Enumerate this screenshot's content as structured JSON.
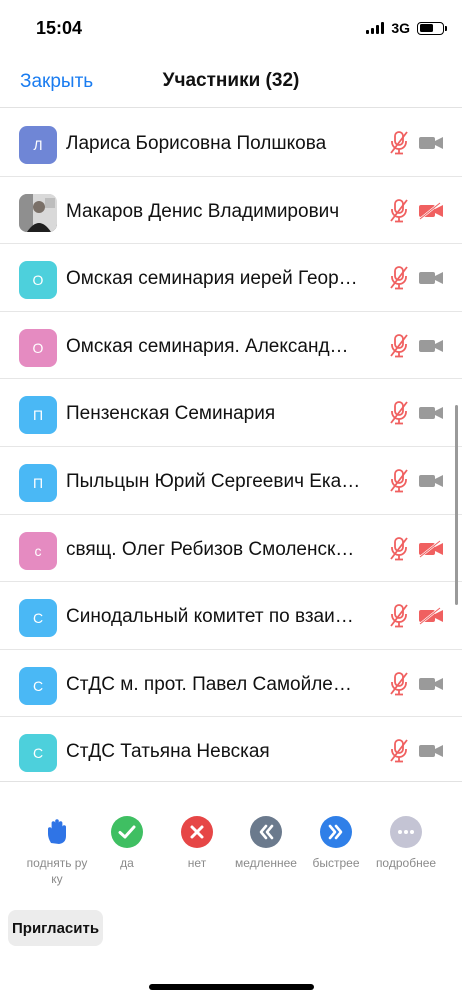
{
  "status_bar": {
    "time": "15:04",
    "network": "3G",
    "battery_level": 0.6
  },
  "nav": {
    "close_label": "Закрыть",
    "title": "Участники (32)",
    "accent_color": "#1a7cf0"
  },
  "participants": [
    {
      "initial": "Л",
      "avatar_color": "#6f86d6",
      "name": "Лариса Борисовна Полшкова",
      "mic_muted": true,
      "video_off": false
    },
    {
      "initial": "",
      "avatar_type": "photo",
      "name": "Макаров Денис Владимирович",
      "mic_muted": true,
      "video_off": true
    },
    {
      "initial": "О",
      "avatar_color": "#4dd0dc",
      "name": "Омская семинария иерей Геор…",
      "mic_muted": true,
      "video_off": false
    },
    {
      "initial": "О",
      "avatar_color": "#e58bc1",
      "name": "Омская семинария. Александ…",
      "mic_muted": true,
      "video_off": false
    },
    {
      "initial": "П",
      "avatar_color": "#4ab8f5",
      "name": "Пензенская Семинария",
      "mic_muted": true,
      "video_off": false
    },
    {
      "initial": "П",
      "avatar_color": "#4ab8f5",
      "name": "Пыльцын Юрий Сергеевич Ека…",
      "mic_muted": true,
      "video_off": false
    },
    {
      "initial": "с",
      "avatar_color": "#e58bc1",
      "name": "свящ. Олег Ребизов Смоленск…",
      "mic_muted": true,
      "video_off": true
    },
    {
      "initial": "С",
      "avatar_color": "#4ab8f5",
      "name": "Синодальный комитет по взаи…",
      "mic_muted": true,
      "video_off": true
    },
    {
      "initial": "С",
      "avatar_color": "#4ab8f5",
      "name": "СтДС м. прот. Павел Самойле…",
      "mic_muted": true,
      "video_off": false
    },
    {
      "initial": "С",
      "avatar_color": "#4dd0dc",
      "name": "СтДС Татьяна Невская",
      "mic_muted": true,
      "video_off": false
    }
  ],
  "reactions": [
    {
      "icon": "raise-hand-icon",
      "label": "поднять руку",
      "color": "#2f74e6"
    },
    {
      "icon": "checkmark-icon",
      "label": "да",
      "color": "#3fbf62"
    },
    {
      "icon": "cross-icon",
      "label": "нет",
      "color": "#e64646"
    },
    {
      "icon": "rewind-icon",
      "label": "медленнее",
      "color": "#6b7a8d"
    },
    {
      "icon": "fast-forward-icon",
      "label": "быстрее",
      "color": "#2f7fe8"
    },
    {
      "icon": "more-icon",
      "label": "подробнее",
      "color": "#c4c4d4"
    }
  ],
  "invite_label": "Пригласить",
  "colors": {
    "muted_red": "#f06060",
    "camera_gray": "#9a9a9a"
  }
}
